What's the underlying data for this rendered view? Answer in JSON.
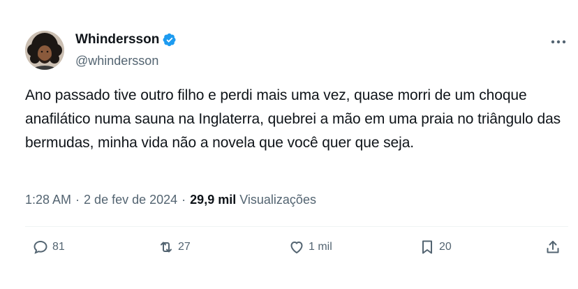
{
  "author": {
    "name": "Whindersson",
    "handle": "@whindersson",
    "verified": true,
    "verified_color": "#1d9bf0"
  },
  "tweet": {
    "text": "Ano passado tive outro filho e perdi mais uma vez, quase morri de um choque anafilático numa sauna na Inglaterra, quebrei a mão em uma praia no triângulo das bermudas, minha vida não a novela que você quer que seja.",
    "time": "1:28 AM",
    "date": "2 de fev de 2024",
    "separator": "·",
    "views_count": "29,9 mil",
    "views_label": "Visualizações"
  },
  "actions": {
    "replies": "81",
    "retweets": "27",
    "likes": "1 mil",
    "bookmarks": "20"
  },
  "icons": [
    "more-icon",
    "verified-icon",
    "reply-icon",
    "retweet-icon",
    "like-icon",
    "bookmark-icon",
    "share-icon"
  ],
  "colors": {
    "text_primary": "#0f1419",
    "text_secondary": "#536471",
    "divider": "#eff3f4"
  }
}
